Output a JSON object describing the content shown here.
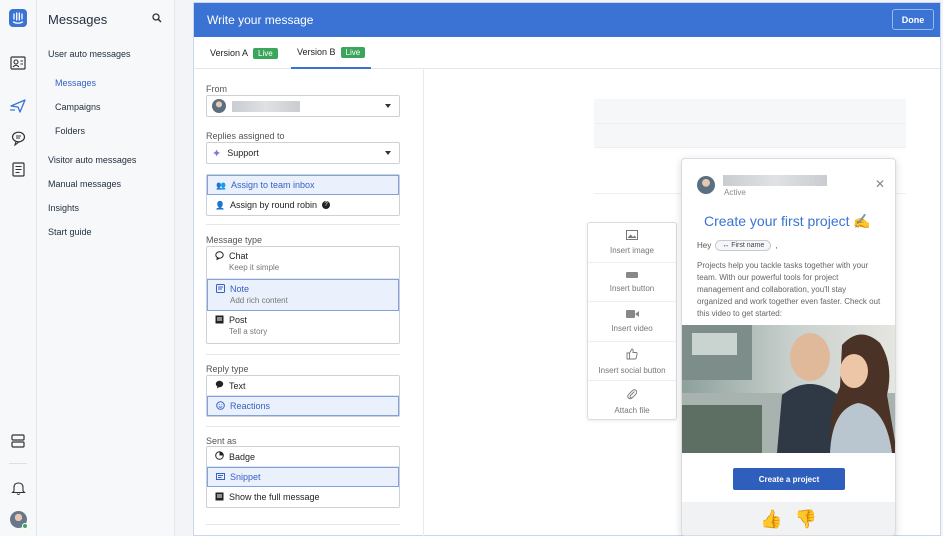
{
  "nav": {
    "title": "Messages",
    "items": [
      {
        "label": "User auto messages"
      },
      {
        "label": "Messages"
      },
      {
        "label": "Campaigns"
      },
      {
        "label": "Folders"
      },
      {
        "label": "Visitor auto messages"
      },
      {
        "label": "Manual messages"
      },
      {
        "label": "Insights"
      },
      {
        "label": "Start guide"
      }
    ],
    "active": "Messages"
  },
  "rail_icons": [
    "intercom-logo-icon",
    "contacts-icon",
    "outbound-icon",
    "inbox-icon",
    "articles-icon",
    "apps-icon",
    "notifications-icon",
    "user-avatar"
  ],
  "editor": {
    "title": "Write your message",
    "done_label": "Done",
    "tabs": [
      {
        "label": "Version A",
        "badge": "Live"
      },
      {
        "label": "Version B",
        "badge": "Live"
      }
    ],
    "from_label": "From",
    "replies_label": "Replies assigned to",
    "replies_value": "Support",
    "assign_options": [
      "Assign to team inbox",
      "Assign by round robin"
    ],
    "message_type_label": "Message type",
    "message_types": [
      {
        "title": "Chat",
        "subtitle": "Keep it simple"
      },
      {
        "title": "Note",
        "subtitle": "Add rich content"
      },
      {
        "title": "Post",
        "subtitle": "Tell a story"
      }
    ],
    "reply_type_label": "Reply type",
    "reply_types": [
      "Text",
      "Reactions"
    ],
    "sent_as_label": "Sent as",
    "sent_as": [
      "Badge",
      "Snippet",
      "Show the full message"
    ]
  },
  "insert_menu": [
    "Insert image",
    "Insert button",
    "Insert video",
    "Insert social button",
    "Attach file"
  ],
  "preview": {
    "status": "Active",
    "title": "Create your first project ✍️",
    "greeting": "Hey",
    "attribute": "First name",
    "attribute_suffix": ",",
    "body": "Projects help you tackle tasks together with your team. With our powerful tools for project management and collaboration, you'll stay organized and work together even faster. Check out this video to get started:",
    "cta": "Create a project",
    "reactions": [
      "👍",
      "👎"
    ]
  },
  "colors": {
    "accent": "#3a73d3",
    "live": "#3ba55c",
    "selected_bg": "#eaf1fc"
  }
}
